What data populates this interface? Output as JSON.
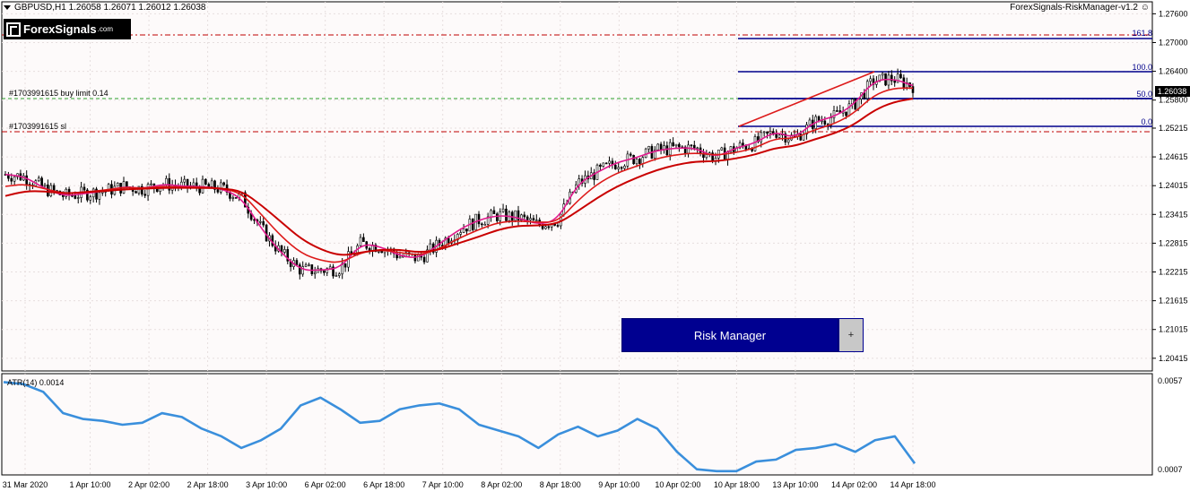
{
  "header": {
    "symbol_line": "GBPUSD,H1  1.26058 1.26071 1.26012 1.26038",
    "ea_name": "ForexSignals-RiskManager-v1.2",
    "logo_text": "ForexSignals",
    "logo_suffix": ".com"
  },
  "colors": {
    "ema_fast": "#e0198c",
    "ema_mid": "#dd1a1a",
    "ema_slow": "#c90000",
    "fib": "#00008b",
    "atr": "#3a8fdc",
    "button": "#000090",
    "buy_limit_line": "#2aa02a",
    "sl_line": "#c00000"
  },
  "price_axis": {
    "ticks": [
      "1.27600",
      "1.27000",
      "1.26400",
      "1.25800",
      "1.25215",
      "1.24615",
      "1.24015",
      "1.23415",
      "1.22815",
      "1.22215",
      "1.21615",
      "1.21015",
      "1.20415"
    ],
    "current_price": "1.26038"
  },
  "time_axis": {
    "labels": [
      "31 Mar 2020",
      "1 Apr 10:00",
      "2 Apr 02:00",
      "2 Apr 18:00",
      "3 Apr 10:00",
      "6 Apr 02:00",
      "6 Apr 18:00",
      "7 Apr 10:00",
      "8 Apr 02:00",
      "8 Apr 18:00",
      "9 Apr 10:00",
      "10 Apr 02:00",
      "10 Apr 18:00",
      "13 Apr 10:00",
      "14 Apr 02:00",
      "14 Apr 18:00"
    ]
  },
  "orders": {
    "buy_limit_label": "#1703991615 buy limit 0.14",
    "sl_label": "#1703991615 sl"
  },
  "fibonacci": {
    "levels": [
      "161.8",
      "100.0",
      "50.0",
      "0.0"
    ]
  },
  "atr": {
    "label": "ATR(14) 0.0014",
    "axis_max": "0.0057",
    "axis_min": "0.0007"
  },
  "risk_manager": {
    "button_label": "Risk Manager",
    "plus_label": "+"
  },
  "chart_data": {
    "type": "line",
    "title": "GBPUSD,H1",
    "ylim": [
      1.2015,
      1.2785
    ],
    "series": [
      {
        "values": [
          1.2425,
          1.242,
          1.2395,
          1.238,
          1.2385,
          1.239,
          1.24,
          1.2395,
          1.2405,
          1.24,
          1.24,
          1.2395,
          1.2375,
          1.231,
          1.226,
          1.2225,
          1.2225,
          1.223,
          1.228,
          1.2275,
          1.2255,
          1.225,
          1.228,
          1.231,
          1.233,
          1.234,
          1.2335,
          1.232,
          1.233,
          1.2405,
          1.243,
          1.245,
          1.246,
          1.2475,
          1.248,
          1.248,
          1.246,
          1.248,
          1.249,
          1.2515,
          1.25,
          1.2535,
          1.2545,
          1.257,
          1.262,
          1.2625,
          1.261
        ]
      },
      {
        "values": [
          1.24,
          1.2405,
          1.2395,
          1.2385,
          1.2388,
          1.2392,
          1.2398,
          1.2396,
          1.24,
          1.2398,
          1.2398,
          1.2396,
          1.2385,
          1.234,
          1.2295,
          1.226,
          1.2245,
          1.224,
          1.2262,
          1.2268,
          1.2262,
          1.2256,
          1.227,
          1.2292,
          1.231,
          1.2325,
          1.2328,
          1.2325,
          1.2326,
          1.237,
          1.2405,
          1.2428,
          1.2442,
          1.2458,
          1.2466,
          1.247,
          1.2465,
          1.247,
          1.248,
          1.25,
          1.25,
          1.2518,
          1.253,
          1.2552,
          1.259,
          1.2605,
          1.2605
        ]
      },
      {
        "values": [
          1.238,
          1.239,
          1.239,
          1.2385,
          1.2388,
          1.239,
          1.2394,
          1.2395,
          1.2397,
          1.2397,
          1.2397,
          1.2396,
          1.239,
          1.236,
          1.2325,
          1.229,
          1.2268,
          1.2255,
          1.2262,
          1.2268,
          1.2268,
          1.2262,
          1.2268,
          1.2282,
          1.2295,
          1.231,
          1.2318,
          1.2318,
          1.2322,
          1.2348,
          1.2376,
          1.24,
          1.2418,
          1.2434,
          1.2445,
          1.2452,
          1.2452,
          1.2458,
          1.2466,
          1.248,
          1.2484,
          1.2498,
          1.251,
          1.2528,
          1.2558,
          1.2576,
          1.2583
        ]
      },
      {
        "values": [
          0.0054,
          0.0053,
          0.0049,
          0.0038,
          0.0035,
          0.0034,
          0.0032,
          0.0033,
          0.0038,
          0.0036,
          0.003,
          0.0026,
          0.002,
          0.0024,
          0.003,
          0.0042,
          0.0046,
          0.004,
          0.0033,
          0.0034,
          0.004,
          0.0042,
          0.0043,
          0.004,
          0.0032,
          0.0029,
          0.0026,
          0.002,
          0.0027,
          0.0031,
          0.0026,
          0.0029,
          0.0035,
          0.003,
          0.0018,
          0.0009,
          0.0008,
          0.0008,
          0.0013,
          0.0014,
          0.0019,
          0.002,
          0.0022,
          0.0018,
          0.0024,
          0.0026,
          0.0012
        ]
      }
    ]
  }
}
